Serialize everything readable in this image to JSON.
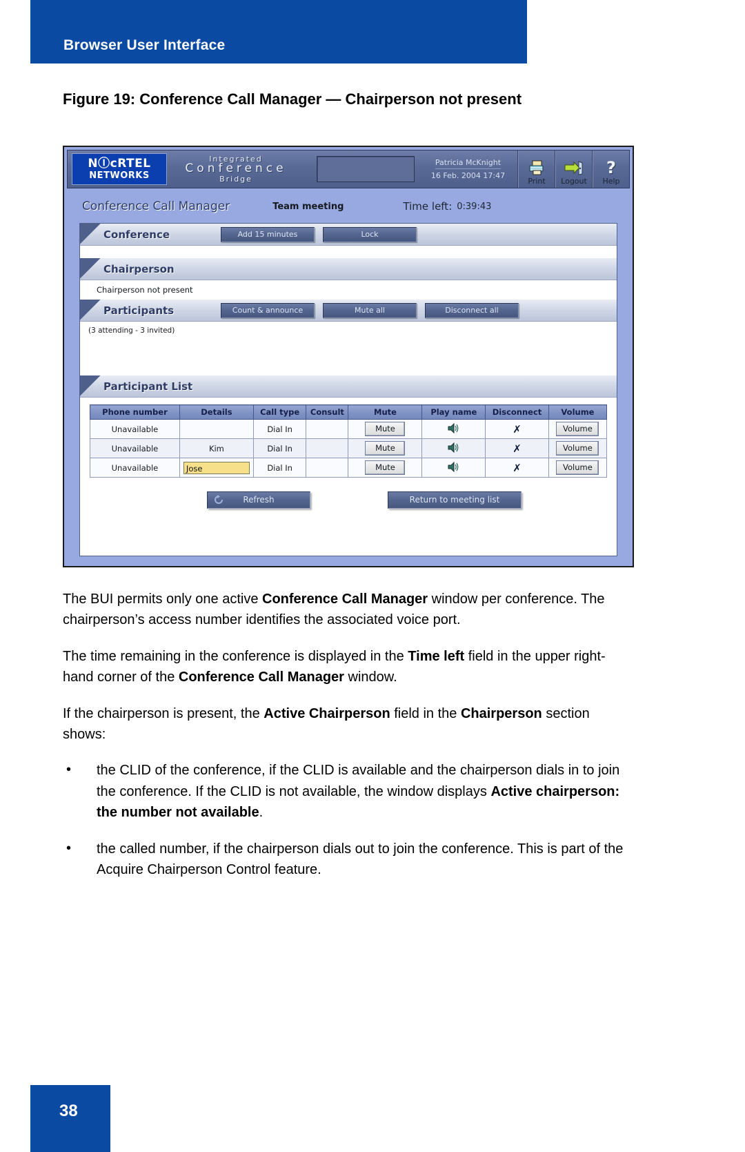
{
  "running_head": {
    "title": "Browser User Interface"
  },
  "figure": {
    "caption": "Figure 19: Conference Call Manager — Chairperson not present"
  },
  "screenshot": {
    "appbar": {
      "logo_line1": "NⒾcRTEL",
      "logo_line2": "NETWORKS",
      "brand_line1": "Integrated",
      "brand_line2": "Conference",
      "brand_line3": "Bridge",
      "search_value": "",
      "user_name": "Patricia McKnight",
      "timestamp": "16 Feb. 2004 17:47",
      "tools": [
        {
          "label": "Print",
          "icon": "printer-icon"
        },
        {
          "label": "Logout",
          "icon": "logout-door-icon"
        },
        {
          "label": "Help",
          "icon": "question-mark-icon"
        }
      ]
    },
    "title_row": {
      "page_title": "Conference Call Manager",
      "meeting_name": "Team meeting",
      "time_left_label": "Time left:",
      "time_left_value": "0:39:43"
    },
    "conference_section": {
      "heading": "Conference",
      "buttons": [
        "Add 15 minutes",
        "Lock"
      ]
    },
    "chairperson_section": {
      "heading": "Chairperson",
      "status": "Chairperson not present"
    },
    "participants_section": {
      "heading": "Participants",
      "buttons": [
        "Count & announce",
        "Mute all",
        "Disconnect all"
      ],
      "count_note": "(3 attending - 3 invited)"
    },
    "participant_list": {
      "heading": "Participant List",
      "columns": [
        "Phone number",
        "Details",
        "Call type",
        "Consult",
        "Mute",
        "Play name",
        "Disconnect",
        "Volume"
      ],
      "rows": [
        {
          "phone_number": "Unavailable",
          "details": "",
          "details_editable": false,
          "call_type": "Dial In",
          "consult": "",
          "mute": "Mute",
          "play_name_icon": "speaker-icon",
          "disconnect_icon": "x-mark-icon",
          "volume": "Volume"
        },
        {
          "phone_number": "Unavailable",
          "details": "Kim",
          "details_editable": false,
          "call_type": "Dial In",
          "consult": "",
          "mute": "Mute",
          "play_name_icon": "speaker-icon",
          "disconnect_icon": "x-mark-icon",
          "volume": "Volume"
        },
        {
          "phone_number": "Unavailable",
          "details": "Jose",
          "details_editable": true,
          "call_type": "Dial In",
          "consult": "",
          "mute": "Mute",
          "play_name_icon": "speaker-icon",
          "disconnect_icon": "x-mark-icon",
          "volume": "Volume"
        }
      ]
    },
    "footer_buttons": {
      "refresh": "Refresh",
      "refresh_icon": "refresh-circular-arrow-icon",
      "return_to_meeting_list": "Return to meeting list"
    },
    "colors": {
      "app_chrome": "#4e5f8c",
      "window_background": "#97a9e0",
      "table_header": "#7f92c4",
      "highlight_field": "#f7e08a",
      "brand_blue": "#0b3fb0"
    }
  },
  "body": {
    "paragraphs": [
      {
        "runs": [
          {
            "t": "The BUI permits only one active "
          },
          {
            "t": "Conference Call Manager",
            "b": true
          },
          {
            "t": " window per conference. The chairperson’s access number identifies the associated voice port."
          }
        ]
      },
      {
        "runs": [
          {
            "t": "The time remaining in the conference is displayed in the "
          },
          {
            "t": "Time left",
            "b": true
          },
          {
            "t": " field in the upper right-hand corner of the "
          },
          {
            "t": "Conference Call Manager",
            "b": true
          },
          {
            "t": " window."
          }
        ]
      },
      {
        "runs": [
          {
            "t": "If the chairperson is present, the "
          },
          {
            "t": "Active Chairperson",
            "b": true
          },
          {
            "t": " field in the "
          },
          {
            "t": "Chairperson",
            "b": true
          },
          {
            "t": " section shows:"
          }
        ]
      }
    ],
    "bullets": [
      {
        "marker": "•",
        "runs": [
          {
            "t": "the CLID of the conference, if the CLID is available and the chairperson dials in to join the conference. If the CLID is not available, the window displays "
          },
          {
            "t": "Active chairperson: the number not available",
            "b": true
          },
          {
            "t": "."
          }
        ]
      },
      {
        "marker": "•",
        "runs": [
          {
            "t": "the called number, if the chairperson dials out to join the conference. This is part of the Acquire Chairperson Control feature."
          }
        ]
      }
    ]
  },
  "page_number": "38"
}
